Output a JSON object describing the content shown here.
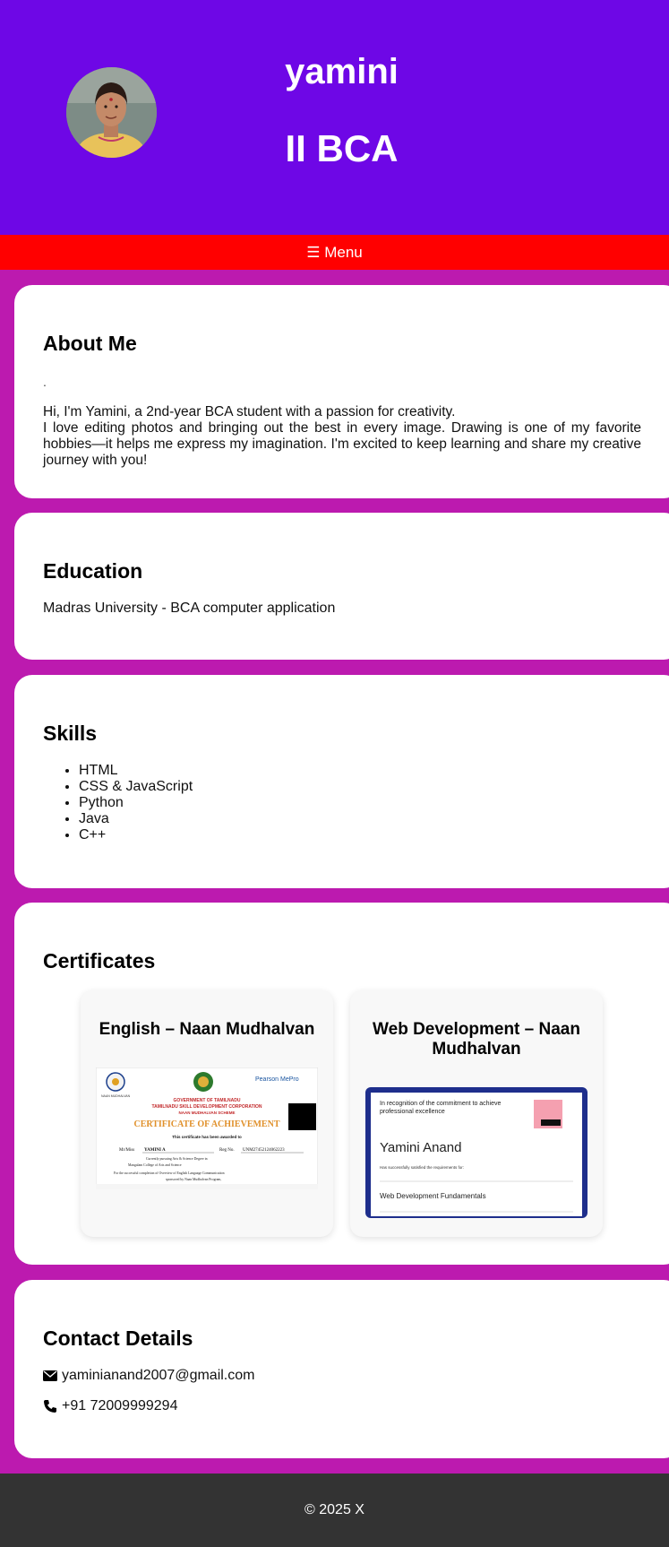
{
  "header": {
    "name": "yamini",
    "subtitle": "II BCA"
  },
  "menu": {
    "label": "☰ Menu"
  },
  "about": {
    "heading": "About Me",
    "dot": ".",
    "line1": "Hi, I'm Yamini, a 2nd-year BCA student with a passion for creativity.",
    "line2": "I love editing photos and bringing out the best in every image. Drawing is one of my favorite hobbies—it helps me express my imagination. I'm excited to keep learning and share my creative journey with you!"
  },
  "education": {
    "heading": "Education",
    "text": "Madras University - BCA computer application"
  },
  "skills": {
    "heading": "Skills",
    "items": [
      "HTML",
      "CSS & JavaScript",
      "Python",
      "Java",
      "C++"
    ]
  },
  "certificates": {
    "heading": "Certificates",
    "items": [
      {
        "title": "English – Naan Mudhalvan",
        "image": {
          "logo_left": "NAAN MUDHALVAN",
          "logo_right": "Pearson  MePro",
          "gov": "GOVERNMENT OF TAMILNADU",
          "corp": "TAMILNADU SKILL DEVELOPMENT CORPORATION",
          "scheme": "NAAN MUDHALVAN SCHEME",
          "cert_title": "CERTIFICATE OF ACHIEVEMENT",
          "awarded": "This certificate has been awarded to",
          "name_label": "Mr/Miss",
          "name": "YAMINI A",
          "reg_label": "Reg No.",
          "reg": "UNM27452124062223",
          "pursuing": "Currently pursuing  Arts & Science Degree in",
          "college": "Mangalam College of Arts and Science",
          "completion": "For the successful completion of  Overview of English Language Communication",
          "sponsor": "sponsored by Naan Mudhalvan Program,"
        }
      },
      {
        "title": "Web Development – Naan Mudhalvan",
        "image": {
          "recognition": "In recognition of the commitment to achieve professional excellence",
          "name": "Yamini Anand",
          "satisfied": "Has successfully satisfied the requirements for:",
          "course": "Web Development Fundamentals"
        }
      }
    ]
  },
  "contact": {
    "heading": "Contact Details",
    "email": "yaminianand2007@gmail.com",
    "phone": "+91 72009999294"
  },
  "footer": {
    "text": "© 2025 X"
  },
  "colors": {
    "header_bg": "#6e07e6",
    "menu_bg": "#ff0000",
    "page_bg": "#bc1aaf",
    "footer_bg": "#333333"
  }
}
